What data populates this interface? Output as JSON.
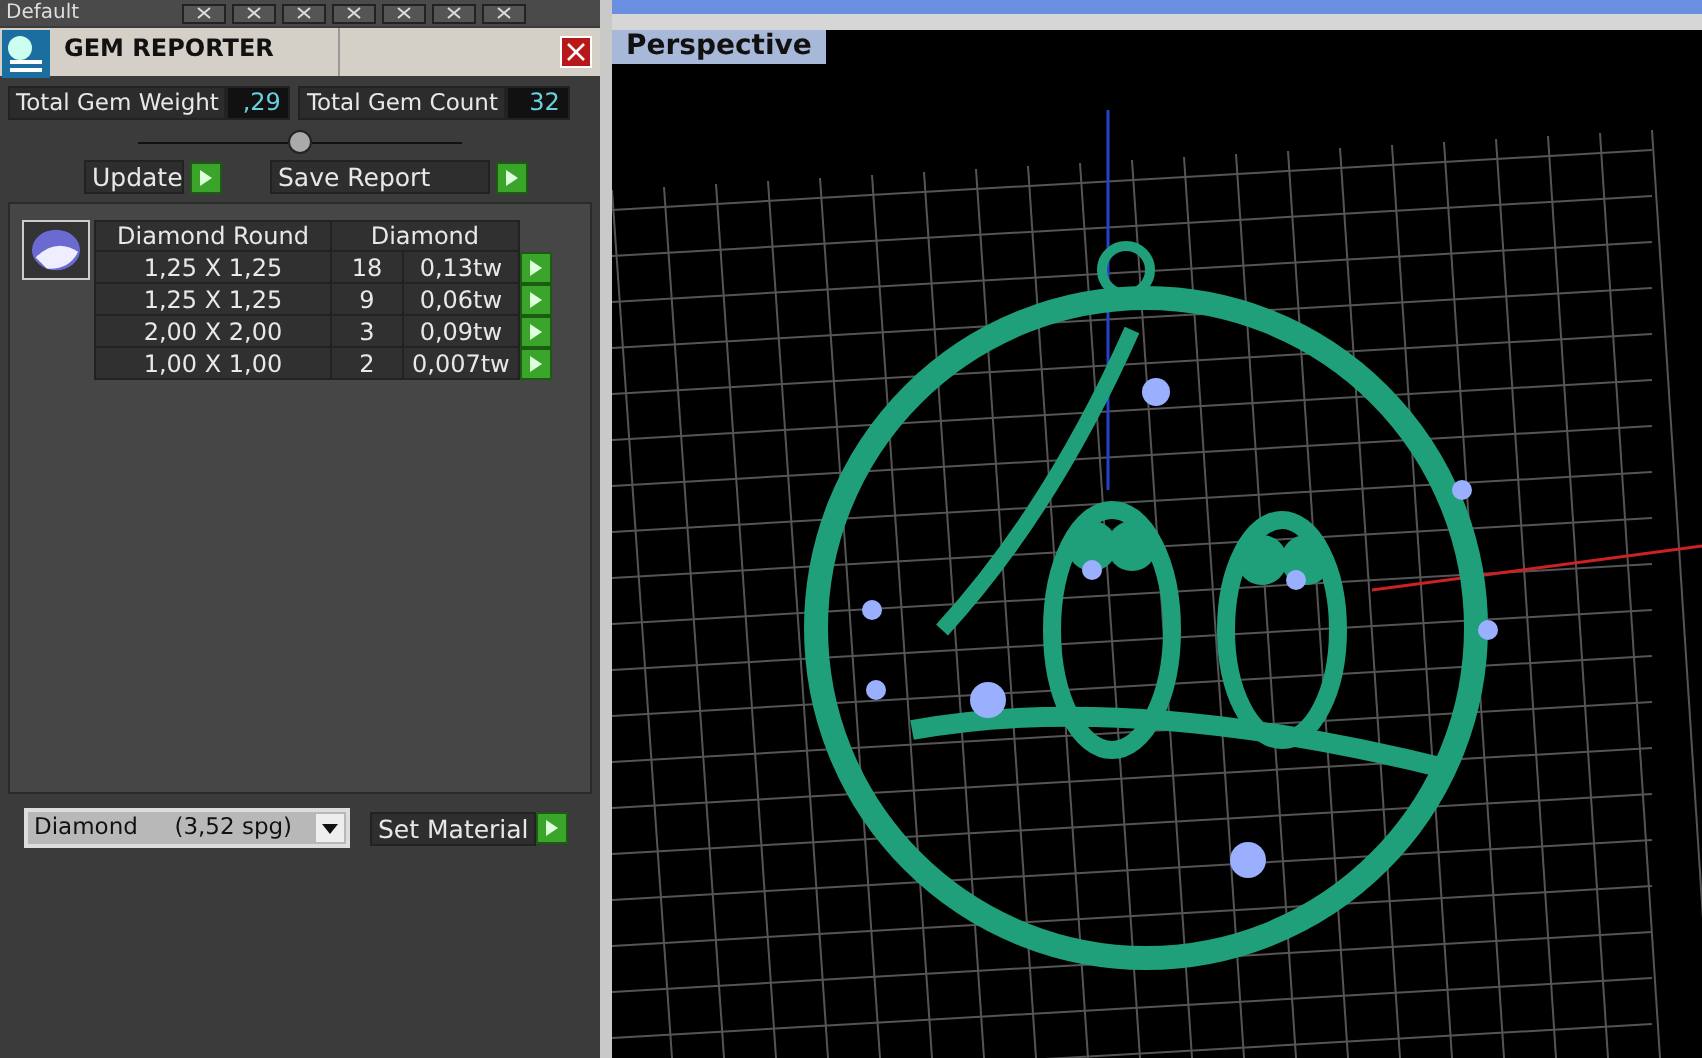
{
  "toolbar": {
    "preset": "Default"
  },
  "panel": {
    "title": "GEM REPORTER",
    "totals": [
      {
        "label": "Total Gem Weight",
        "value": ",29"
      },
      {
        "label": "Total Gem Count",
        "value": "32"
      }
    ],
    "buttons": [
      "Update",
      "Save Report"
    ],
    "table": {
      "columns": [
        "Diamond Round",
        "Diamond"
      ],
      "rows": [
        {
          "size": "1,25 X 1,25",
          "count": "18",
          "weight": "0,13tw"
        },
        {
          "size": "1,25 X 1,25",
          "count": "9",
          "weight": "0,06tw"
        },
        {
          "size": "2,00 X 2,00",
          "count": "3",
          "weight": "0,09tw"
        },
        {
          "size": "1,00 X 1,00",
          "count": "2",
          "weight": "0,007tw"
        }
      ]
    },
    "material": {
      "value": "Diamond     (3,52 spg)",
      "button": "Set Material"
    }
  },
  "viewport": {
    "label": "Perspective"
  }
}
